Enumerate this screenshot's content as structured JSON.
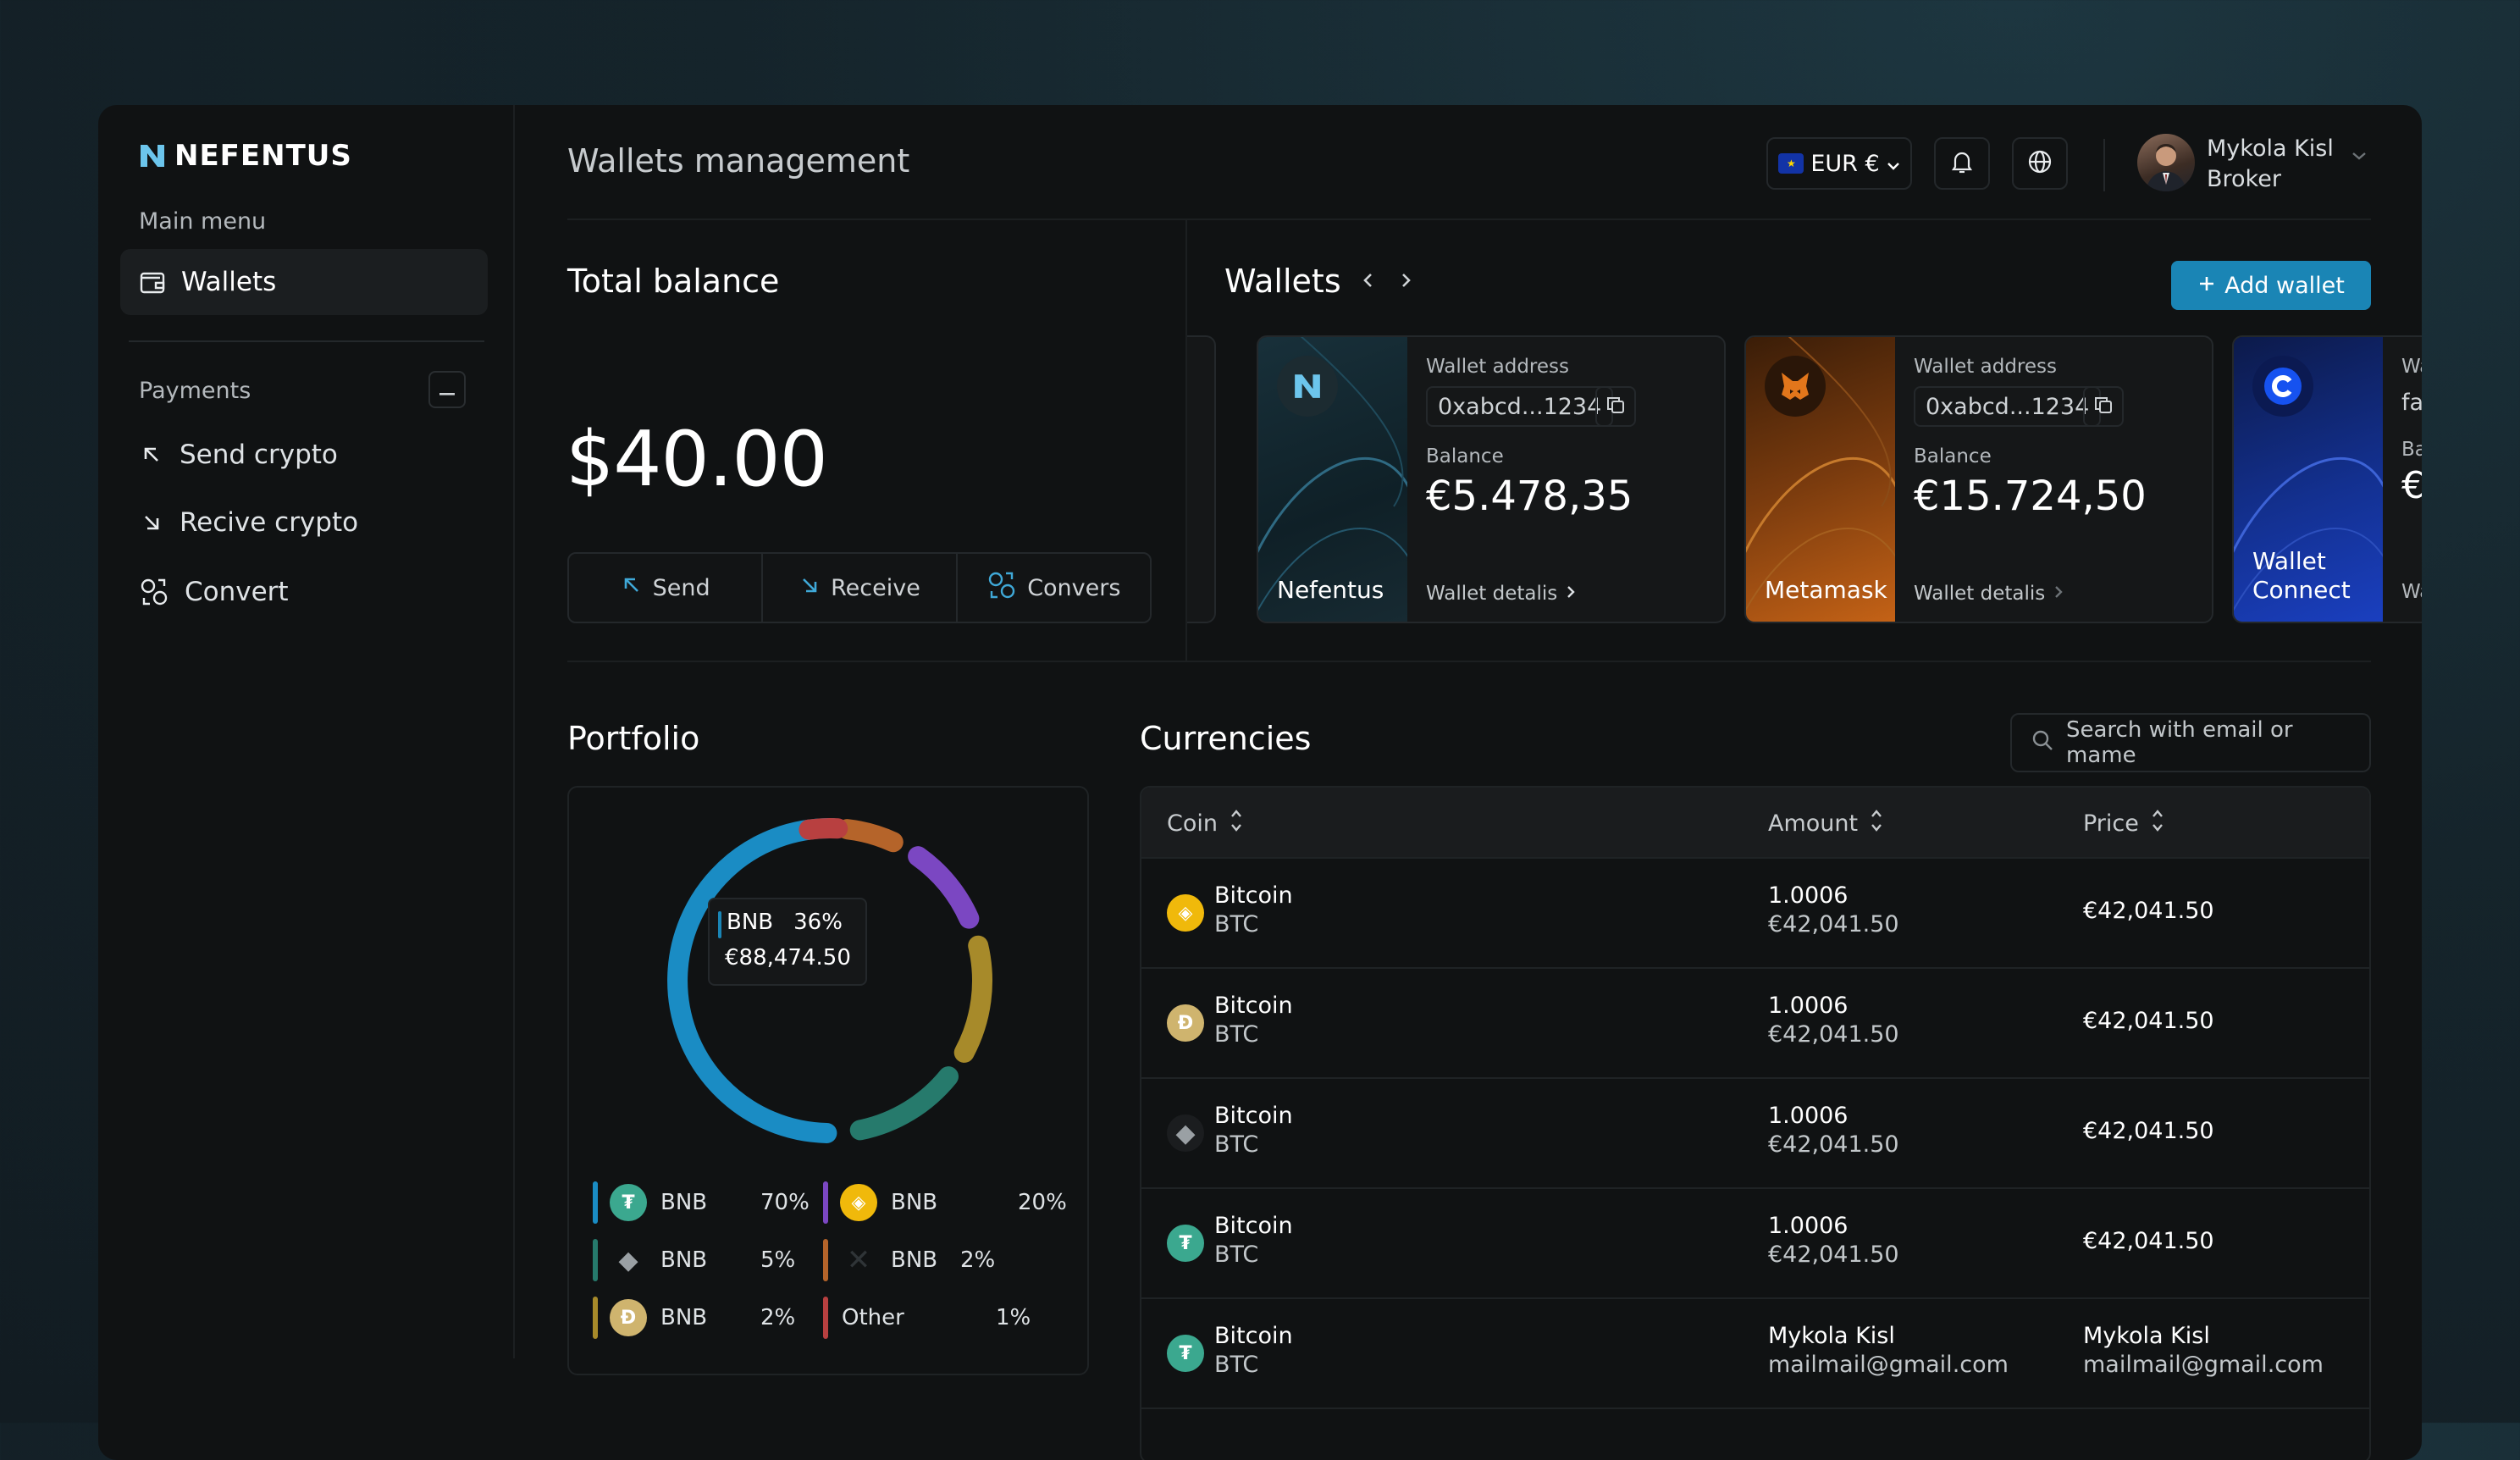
{
  "brand": {
    "name": "NEFENTUS"
  },
  "sidebar": {
    "main_menu_label": "Main menu",
    "wallets_label": "Wallets",
    "payments_label": "Payments",
    "items": [
      {
        "label": "Send crypto"
      },
      {
        "label": "Recive crypto"
      },
      {
        "label": "Convert"
      }
    ]
  },
  "header": {
    "title": "Wallets management",
    "currency": "EUR €",
    "user_name": "Mykola Kisl",
    "user_role": "Broker"
  },
  "total_balance": {
    "title": "Total balance",
    "amount": "$40.00",
    "actions": {
      "send": "Send",
      "receive": "Receive",
      "convert": "Convers"
    }
  },
  "wallets": {
    "title": "Wallets",
    "add_label": "Add wallet",
    "address_label": "Wallet address",
    "balance_label": "Balance",
    "details_label": "Wallet detalis",
    "cards": [
      {
        "name": "Nefentus",
        "address": "0xabcd...1234",
        "balance": "€5.478,35"
      },
      {
        "name": "Metamask",
        "address": "0xabcd...1234",
        "balance": "€15.724,50"
      },
      {
        "name_line1": "Wallet",
        "name_line2": "Connect",
        "address_partial": "Wa",
        "addr_partial2": "fa",
        "bal_partial_label": "Ba",
        "bal_partial": "€",
        "details_partial": "Wa"
      }
    ]
  },
  "portfolio": {
    "title": "Portfolio",
    "tooltip": {
      "coin": "BNB",
      "pct": "36%",
      "value": "€88,474.50"
    },
    "segments": [
      {
        "color": "#1a8cc4",
        "from": 0.0,
        "to": 0.5
      },
      {
        "color": "#267a6c",
        "from": 0.535,
        "to": 0.645
      },
      {
        "color": "#a78a2a",
        "from": 0.675,
        "to": 0.79
      },
      {
        "color": "#7b47c2",
        "from": 0.82,
        "to": 0.905
      },
      {
        "color": "#b5642a",
        "from": 0.935,
        "to": 0.985
      },
      {
        "color": "#b84040",
        "from": 0.995,
        "to": 1.025
      }
    ],
    "legend": [
      {
        "name": "BNB",
        "pct": "70%",
        "color": "#1a8cc4",
        "icon": "tether-icon"
      },
      {
        "name": "BNB",
        "pct": "20%",
        "color": "#7b47c2",
        "icon": "bnb-icon"
      },
      {
        "name": "BNB",
        "pct": "5%",
        "color": "#267a6c",
        "icon": "ethereum-icon"
      },
      {
        "name": "BNB",
        "pct": "2%",
        "color": "#b5642a",
        "icon": "x-icon"
      },
      {
        "name": "BNB",
        "pct": "2%",
        "color": "#a78a2a",
        "icon": "doge-icon"
      },
      {
        "name": "Other",
        "pct": "1%",
        "color": "#b84040",
        "icon": ""
      }
    ]
  },
  "currencies": {
    "title": "Currencies",
    "search_placeholder": "Search with email or mame",
    "columns": {
      "coin": "Coin",
      "amount": "Amount",
      "price": "Price"
    },
    "rows": [
      {
        "name": "Bitcoin",
        "symbol": "BTC",
        "amount": "1.0006",
        "amount_fiat": "€42,041.50",
        "price": "€42,041.50",
        "icon": "bnb-icon"
      },
      {
        "name": "Bitcoin",
        "symbol": "BTC",
        "amount": "1.0006",
        "amount_fiat": "€42,041.50",
        "price": "€42,041.50",
        "icon": "doge-icon"
      },
      {
        "name": "Bitcoin",
        "symbol": "BTC",
        "amount": "1.0006",
        "amount_fiat": "€42,041.50",
        "price": "€42,041.50",
        "icon": "ethereum-icon"
      },
      {
        "name": "Bitcoin",
        "symbol": "BTC",
        "amount": "1.0006",
        "amount_fiat": "€42,041.50",
        "price": "€42,041.50",
        "icon": "tether-icon"
      },
      {
        "name": "Bitcoin",
        "symbol": "BTC",
        "amount": "Mykola Kisl",
        "amount_fiat": "mailmail@gmail.com",
        "price": "Mykola Kisl",
        "price_sub": "mailmail@gmail.com",
        "icon": "tether-icon"
      }
    ]
  }
}
